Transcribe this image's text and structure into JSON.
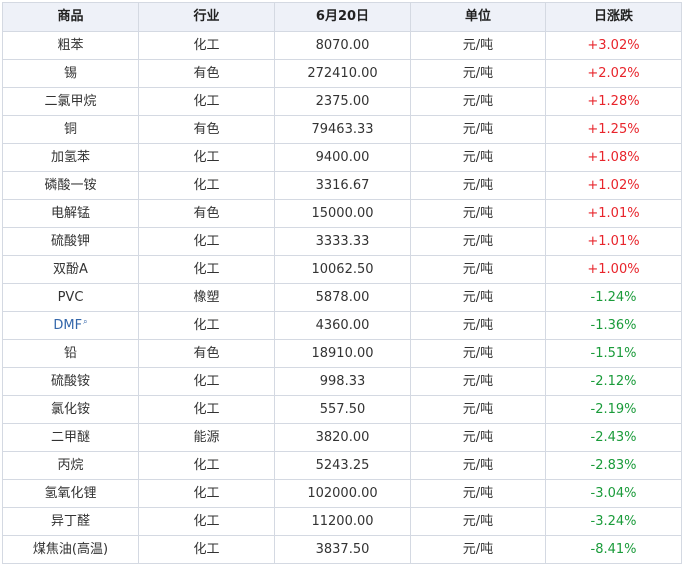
{
  "headers": [
    "商品",
    "行业",
    "6月20日",
    "单位",
    "日涨跌"
  ],
  "colors": {
    "up": "#e8242b",
    "down": "#1a9b3a",
    "link": "#3366aa",
    "header_bg": "#eef1f8",
    "border": "#d4d9e2"
  },
  "rows": [
    {
      "name": "粗苯",
      "industry": "化工",
      "price": "8070.00",
      "unit": "元/吨",
      "change": "+3.02%",
      "dir": "up"
    },
    {
      "name": "锡",
      "industry": "有色",
      "price": "272410.00",
      "unit": "元/吨",
      "change": "+2.02%",
      "dir": "up"
    },
    {
      "name": "二氯甲烷",
      "industry": "化工",
      "price": "2375.00",
      "unit": "元/吨",
      "change": "+1.28%",
      "dir": "up"
    },
    {
      "name": "铜",
      "industry": "有色",
      "price": "79463.33",
      "unit": "元/吨",
      "change": "+1.25%",
      "dir": "up"
    },
    {
      "name": "加氢苯",
      "industry": "化工",
      "price": "9400.00",
      "unit": "元/吨",
      "change": "+1.08%",
      "dir": "up"
    },
    {
      "name": "磷酸一铵",
      "industry": "化工",
      "price": "3316.67",
      "unit": "元/吨",
      "change": "+1.02%",
      "dir": "up"
    },
    {
      "name": "电解锰",
      "industry": "有色",
      "price": "15000.00",
      "unit": "元/吨",
      "change": "+1.01%",
      "dir": "up"
    },
    {
      "name": "硫酸钾",
      "industry": "化工",
      "price": "3333.33",
      "unit": "元/吨",
      "change": "+1.01%",
      "dir": "up"
    },
    {
      "name": "双酚A",
      "industry": "化工",
      "price": "10062.50",
      "unit": "元/吨",
      "change": "+1.00%",
      "dir": "up"
    },
    {
      "name": "PVC",
      "industry": "橡塑",
      "price": "5878.00",
      "unit": "元/吨",
      "change": "-1.24%",
      "dir": "down"
    },
    {
      "name": "DMF",
      "industry": "化工",
      "price": "4360.00",
      "unit": "元/吨",
      "change": "-1.36%",
      "dir": "down",
      "link": true,
      "icon": "search-icon"
    },
    {
      "name": "铅",
      "industry": "有色",
      "price": "18910.00",
      "unit": "元/吨",
      "change": "-1.51%",
      "dir": "down"
    },
    {
      "name": "硫酸铵",
      "industry": "化工",
      "price": "998.33",
      "unit": "元/吨",
      "change": "-2.12%",
      "dir": "down"
    },
    {
      "name": "氯化铵",
      "industry": "化工",
      "price": "557.50",
      "unit": "元/吨",
      "change": "-2.19%",
      "dir": "down"
    },
    {
      "name": "二甲醚",
      "industry": "能源",
      "price": "3820.00",
      "unit": "元/吨",
      "change": "-2.43%",
      "dir": "down"
    },
    {
      "name": "丙烷",
      "industry": "化工",
      "price": "5243.25",
      "unit": "元/吨",
      "change": "-2.83%",
      "dir": "down"
    },
    {
      "name": "氢氧化锂",
      "industry": "化工",
      "price": "102000.00",
      "unit": "元/吨",
      "change": "-3.04%",
      "dir": "down"
    },
    {
      "name": "异丁醛",
      "industry": "化工",
      "price": "11200.00",
      "unit": "元/吨",
      "change": "-3.24%",
      "dir": "down"
    },
    {
      "name": "煤焦油(高温)",
      "industry": "化工",
      "price": "3837.50",
      "unit": "元/吨",
      "change": "-8.41%",
      "dir": "down"
    }
  ]
}
